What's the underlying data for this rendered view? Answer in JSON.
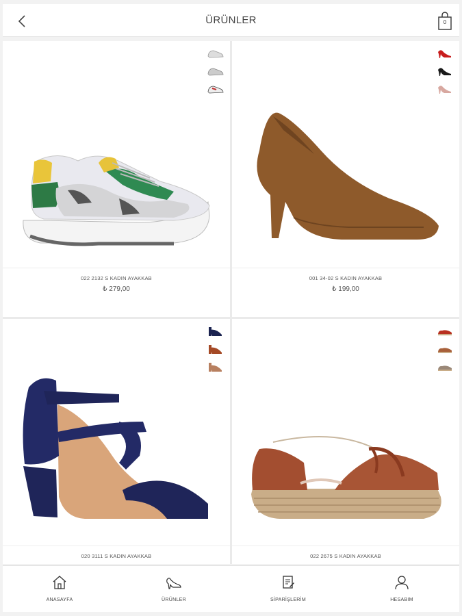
{
  "header": {
    "title": "ÜRÜNLER",
    "back_icon": "chevron-left-icon",
    "cart_icon": "shopping-bag-icon",
    "cart_count": "0"
  },
  "products": [
    {
      "name": "022 2132 S KADIN AYAKKAB",
      "price": "₺ 279,00",
      "image": "sneaker-white-green-yellow",
      "swatches": [
        "#c8c8c8",
        "#b0b0b0",
        "#c03030"
      ]
    },
    {
      "name": "001 34-02 S KADIN AYAKKAB",
      "price": "₺ 199,00",
      "image": "pump-brown-suede",
      "swatches": [
        "#c81c1c",
        "#1a1a1a",
        "#d8a8a0"
      ]
    },
    {
      "name": "020 3111 S KADIN AYAKKAB",
      "price": "",
      "image": "sandal-navy-suede",
      "swatches": [
        "#1b2350",
        "#a54a26",
        "#b88060"
      ]
    },
    {
      "name": "022 2675 S KADIN AYAKKAB",
      "price": "",
      "image": "espadrille-rust-suede",
      "swatches": [
        "#b83020",
        "#a8603a",
        "#9a8878"
      ]
    }
  ],
  "bottom_nav": [
    {
      "label": "ANASAYFA",
      "icon": "home-icon"
    },
    {
      "label": "ÜRÜNLER",
      "icon": "heel-shoe-icon"
    },
    {
      "label": "SİPARİŞLERİM",
      "icon": "orders-icon"
    },
    {
      "label": "HESABIM",
      "icon": "user-icon"
    }
  ],
  "colors": {
    "background": "#f2f2f2",
    "text": "#444444",
    "card": "#ffffff"
  }
}
